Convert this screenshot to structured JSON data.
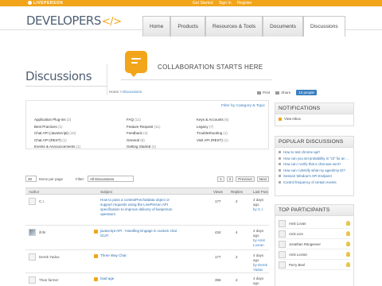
{
  "topbar": {
    "brand": "LIVEPERSON",
    "links": [
      "Get Started",
      "Sign In",
      "Register"
    ]
  },
  "header": {
    "logo": "DEVELOPERS",
    "logo_mark": "</>",
    "nav": [
      {
        "label": "Home"
      },
      {
        "label": "Products"
      },
      {
        "label": "Resources & Tools"
      },
      {
        "label": "Documents"
      },
      {
        "label": "Discussions",
        "active": true
      }
    ]
  },
  "hero": {
    "title": "COLLABORATION STARTS HERE"
  },
  "page": {
    "title": "Discussions",
    "breadcrumb": [
      "Home",
      "Discussions"
    ],
    "tools": [
      "Print",
      "Share",
      "10 people"
    ]
  },
  "categories": {
    "filter_label": "Filter by Category & Topic",
    "items": [
      {
        "name": "Application Plug-ins",
        "count": "(2)"
      },
      {
        "name": "FAQ",
        "count": "(11)"
      },
      {
        "name": "Keys & Accounts",
        "count": "(6)"
      },
      {
        "name": "Best Practices",
        "count": "(1)"
      },
      {
        "name": "Feature Request",
        "count": "(11)"
      },
      {
        "name": "Legacy",
        "count": "(7)"
      },
      {
        "name": "Chat API (JavaScript)",
        "count": "(10)"
      },
      {
        "name": "Feedback",
        "count": "(4)"
      },
      {
        "name": "Troubleshooting",
        "count": "(1)"
      },
      {
        "name": "Chat API (REST)",
        "count": "(1)"
      },
      {
        "name": "General",
        "count": "(8)"
      },
      {
        "name": "Visit API (REST)",
        "count": "(1)"
      },
      {
        "name": "Events & Announcements",
        "count": "(1)"
      },
      {
        "name": "Getting Started",
        "count": "(4)"
      },
      {
        "name": "",
        "count": ""
      }
    ]
  },
  "list_controls": {
    "per_page": "20",
    "per_page_label": "Items per page",
    "filter_label": "Filter:",
    "filter_value": "All Discussions",
    "pager": [
      "1",
      "2",
      "Previous",
      "Next"
    ]
  },
  "table": {
    "headers": [
      "Author",
      "Subject",
      "Views",
      "Replies",
      "Last Post"
    ],
    "rows": [
      {
        "author": "C.I.",
        "subject": "How to pass a contextPrechatdata object or support requests using the LivePerson API specification to improve delivery of liveperson operators",
        "views": "177",
        "replies": "2",
        "last_date": "4 days ago",
        "last_by": "by C.I."
      },
      {
        "author": "ifrihr",
        "subject": "javascript API - Handling Engage in custom chat GUI?",
        "views": "434",
        "replies": "4",
        "last_date": "4 days ago",
        "last_by": "by Amit Lovran"
      },
      {
        "author": "Derek Yadus",
        "subject": "Three Way Chat",
        "views": "177",
        "replies": "2",
        "last_date": "4 days ago",
        "last_by": "by Derek Yadus"
      },
      {
        "author": "Than farmer",
        "subject": "load age",
        "views": "356",
        "replies": "2",
        "last_date": "4 days ago",
        "last_by": ""
      }
    ]
  },
  "sidebar": {
    "notifications": {
      "title": "NOTIFICATIONS",
      "item": "View Inbox"
    },
    "popular": {
      "title": "POPULAR DISCUSSIONS",
      "items": [
        "How to test chrome api?",
        "How can you set probability in \"cli\" for an agent (and other CLI)?",
        "How can I verify that a chat was sent?",
        "How can I identify what my agent/my ID?",
        "Session Window's API Endpoint",
        "Control frequency of certain events"
      ]
    },
    "participants": {
      "title": "TOP PARTICIPANTS",
      "items": [
        "Amit Lovan",
        "Amit Lion",
        "Jonathan Rangeever",
        "Amit Lovran",
        "Perry Beel"
      ]
    }
  }
}
